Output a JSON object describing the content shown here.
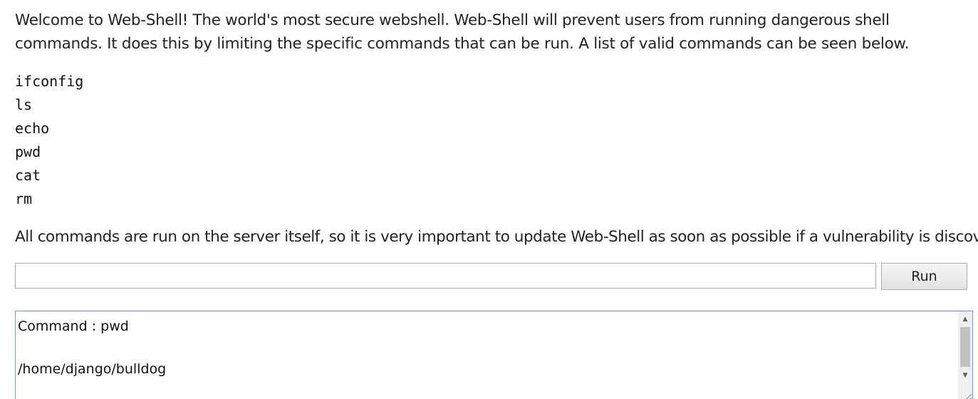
{
  "intro": {
    "text": "Welcome to Web-Shell! The world's most secure webshell. Web-Shell will prevent users from running dangerous shell commands. It does this by limiting the specific commands that can be run. A list of valid commands can be seen below."
  },
  "commands": [
    "ifconfig",
    "ls",
    "echo",
    "pwd",
    "cat",
    "rm"
  ],
  "warning": {
    "text": "All commands are run on the server itself, so it is very important to update Web-Shell as soon as possible if a vulnerability is discovered."
  },
  "form": {
    "input_value": "",
    "run_label": "Run"
  },
  "output": {
    "text": "Command : pwd\n\n/home/django/bulldog"
  },
  "icons": {
    "scroll_up": "scroll-up-arrow-icon",
    "scroll_down": "scroll-down-arrow-icon",
    "resize": "resize-grip-icon"
  },
  "colors": {
    "focus_border": "#6a9be0"
  }
}
